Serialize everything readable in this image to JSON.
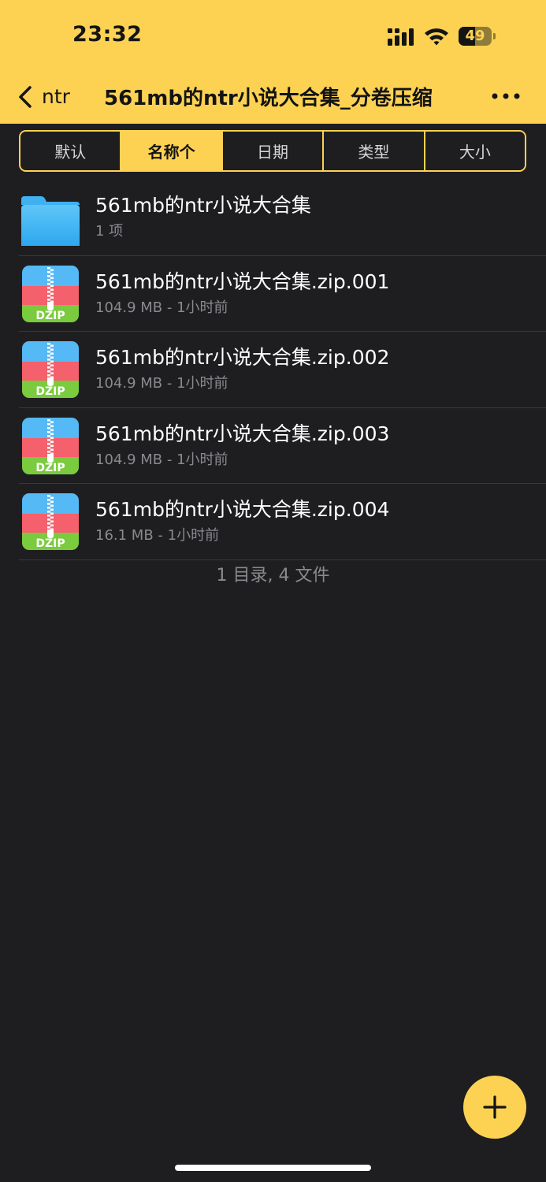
{
  "status_bar": {
    "time": "23:32",
    "battery": "49",
    "battery_level": 0.49
  },
  "nav": {
    "back_label": "ntr",
    "title": "561mb的ntr小说大合集_分卷压缩",
    "more_icon": "more-horizontal-icon"
  },
  "sort": {
    "options": [
      "默认",
      "名称个",
      "日期",
      "类型",
      "大小"
    ],
    "active_index": 1
  },
  "files": [
    {
      "icon": "folder-icon",
      "name": "561mb的ntr小说大合集",
      "meta": "1 项"
    },
    {
      "icon": "zip-archive-icon",
      "badge": "DZIP",
      "name": "561mb的ntr小说大合集.zip.001",
      "meta": "104.9 MB - 1小时前"
    },
    {
      "icon": "zip-archive-icon",
      "badge": "DZIP",
      "name": "561mb的ntr小说大合集.zip.002",
      "meta": "104.9 MB - 1小时前"
    },
    {
      "icon": "zip-archive-icon",
      "badge": "DZIP",
      "name": "561mb的ntr小说大合集.zip.003",
      "meta": "104.9 MB - 1小时前"
    },
    {
      "icon": "zip-archive-icon",
      "badge": "DZIP",
      "name": "561mb的ntr小说大合集.zip.004",
      "meta": "16.1 MB - 1小时前"
    }
  ],
  "summary": "1 目录, 4 文件",
  "fab": {
    "icon": "plus-icon"
  },
  "colors": {
    "accent": "#fdd253",
    "background": "#1e1e20",
    "secondary_text": "#8a8a8e"
  }
}
